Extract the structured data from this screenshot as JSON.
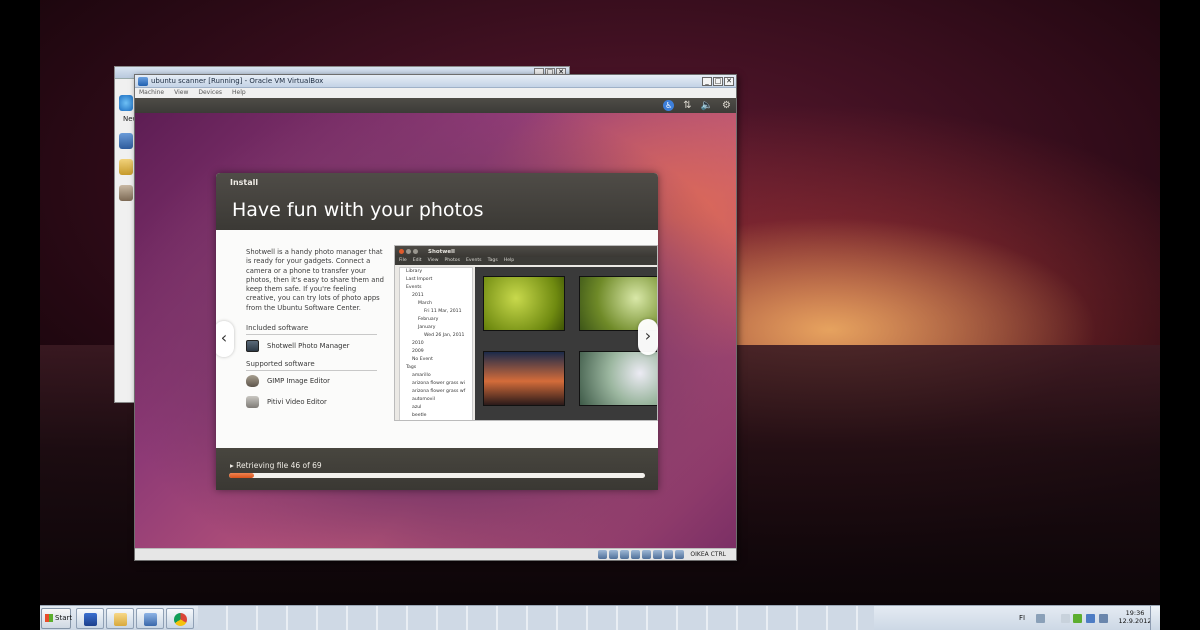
{
  "vm_window": {
    "title": "ubuntu scanner [Running] - Oracle VM VirtualBox",
    "menu": [
      "Machine",
      "View",
      "Devices",
      "Help"
    ],
    "window_buttons": [
      "_",
      "□",
      "✕"
    ],
    "status_host_key": "ОIKEA CTRL"
  },
  "bg_window": {
    "new_label": "New"
  },
  "installer": {
    "label": "Install",
    "heading": "Have fun with your photos",
    "description": "Shotwell is a handy photo manager that is ready for your gadgets. Connect a camera or a phone to transfer your photos, then it's easy to share them and keep them safe. If you're feeling creative, you can try lots of photo apps from the Ubuntu Software Center.",
    "included_title": "Included software",
    "included_apps": [
      "Shotwell Photo Manager"
    ],
    "supported_title": "Supported software",
    "supported_apps": [
      "GIMP Image Editor",
      "Pitivi Video Editor"
    ],
    "prev_arrow": "‹",
    "next_arrow": "›",
    "progress_text": "Retrieving file 46 of 69",
    "progress_fraction": 0.06
  },
  "shotwell": {
    "title": "Shotwell",
    "menu": [
      "File",
      "Edit",
      "View",
      "Photos",
      "Events",
      "Tags",
      "Help"
    ],
    "tree": [
      "Library",
      "Last Import",
      "Events",
      "2011",
      "March",
      "Fri 11 Mar, 2011",
      "February",
      "January",
      "Wed 26 Jan, 2011",
      "2010",
      "2009",
      "No Event",
      "Tags",
      "amarillo",
      "arizona flower grass wi",
      "arizona flower grass wf",
      "automovil",
      "azul",
      "beetle"
    ]
  },
  "taskbar": {
    "start_label": "Start",
    "language": "FI",
    "time": "19:36",
    "date": "12.9.2012"
  },
  "colors": {
    "accent_orange": "#dd4814",
    "ubuntu_panel": "#3c3b37",
    "installer_header": "#4a4843"
  }
}
